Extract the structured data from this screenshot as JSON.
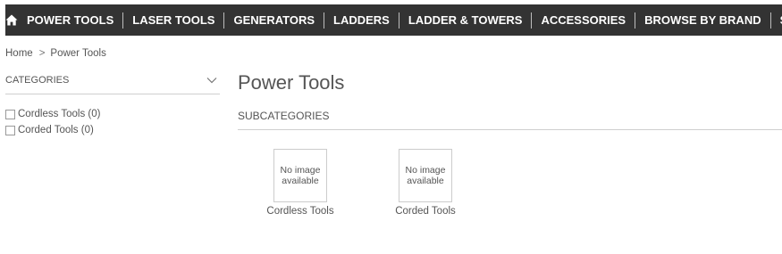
{
  "nav": {
    "home_icon": "home-icon",
    "items": [
      {
        "label": "POWER TOOLS"
      },
      {
        "label": "LASER TOOLS"
      },
      {
        "label": "GENERATORS"
      },
      {
        "label": "LADDERS"
      },
      {
        "label": "LADDER & TOWERS"
      },
      {
        "label": "ACCESSORIES"
      },
      {
        "label": "BROWSE BY BRAND"
      },
      {
        "label": "SALE"
      }
    ]
  },
  "breadcrumb": {
    "home": "Home",
    "separator": ">",
    "current": "Power Tools"
  },
  "sidebar": {
    "heading": "CATEGORIES",
    "chevron_icon": "chevron-down-icon",
    "filters": [
      {
        "label": "Cordless Tools (0)",
        "checked": false
      },
      {
        "label": "Corded Tools (0)",
        "checked": false
      }
    ]
  },
  "main": {
    "title": "Power Tools",
    "subcategories_heading": "SUBCATEGORIES",
    "tiles": [
      {
        "image_text": "No image available",
        "label": "Cordless Tools"
      },
      {
        "image_text": "No image available",
        "label": "Corded Tools"
      }
    ]
  },
  "colors": {
    "nav_background": "#333333",
    "nav_text": "#ffffff",
    "body_text": "#555555",
    "divider": "#cfcfcf"
  }
}
